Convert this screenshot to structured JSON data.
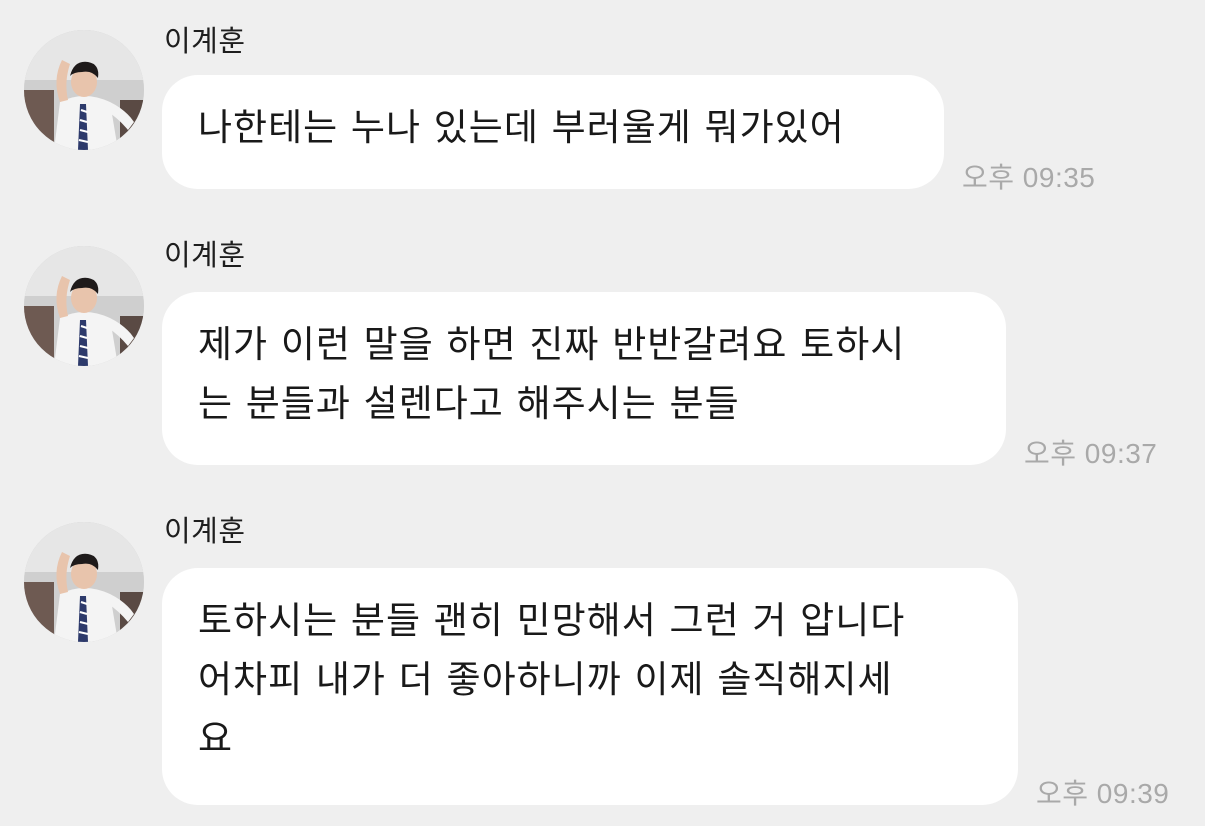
{
  "chat": {
    "messages": [
      {
        "sender": "이계훈",
        "lines": [
          "나한테는 누나 있는데 부러울게 뭐가있어"
        ],
        "time": "오후 09:35"
      },
      {
        "sender": "이계훈",
        "lines": [
          "제가 이런 말을 하면 진짜 반반갈려요 토하시",
          "는 분들과 설렌다고 해주시는 분들"
        ],
        "time": "오후 09:37"
      },
      {
        "sender": "이계훈",
        "lines": [
          "토하시는 분들 괜히 민망해서 그런 거 압니다",
          "어차피 내가 더 좋아하니까 이제 솔직해지세",
          "요"
        ],
        "time": "오후 09:39"
      }
    ]
  },
  "colors": {
    "background": "#efefef",
    "bubble": "#ffffff",
    "text": "#191919",
    "timestamp": "#a9a9a9"
  },
  "icons": {
    "avatar": "profile-photo-avatar"
  }
}
